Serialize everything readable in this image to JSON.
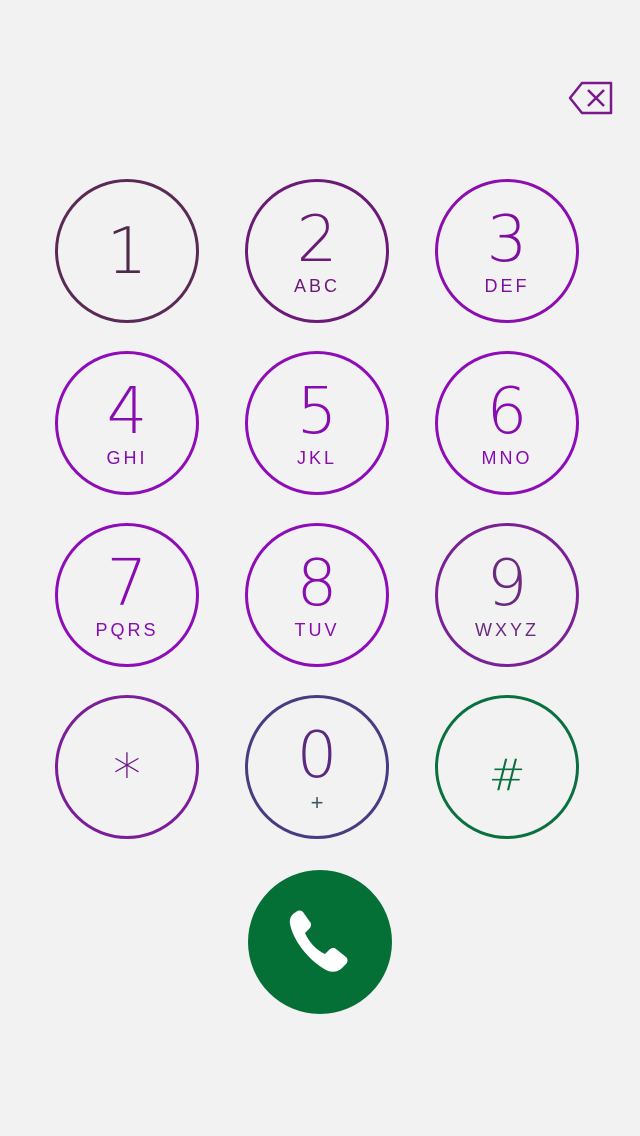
{
  "delete_button": {
    "icon": "backspace-icon",
    "color": "#7a1a8a"
  },
  "keys": [
    {
      "digit": "1",
      "letters": ""
    },
    {
      "digit": "2",
      "letters": "ABC"
    },
    {
      "digit": "3",
      "letters": "DEF"
    },
    {
      "digit": "4",
      "letters": "GHI"
    },
    {
      "digit": "5",
      "letters": "JKL"
    },
    {
      "digit": "6",
      "letters": "MNO"
    },
    {
      "digit": "7",
      "letters": "PQRS"
    },
    {
      "digit": "8",
      "letters": "TUV"
    },
    {
      "digit": "9",
      "letters": "WXYZ"
    },
    {
      "digit": "*",
      "letters": ""
    },
    {
      "digit": "0",
      "letters": "+"
    },
    {
      "digit": "#",
      "letters": ""
    }
  ],
  "call_button": {
    "icon": "phone-icon",
    "color": "#047036"
  },
  "colors": {
    "background": "#f2f2f2",
    "accent_purple": "#8a0fae",
    "accent_green": "#047036"
  }
}
